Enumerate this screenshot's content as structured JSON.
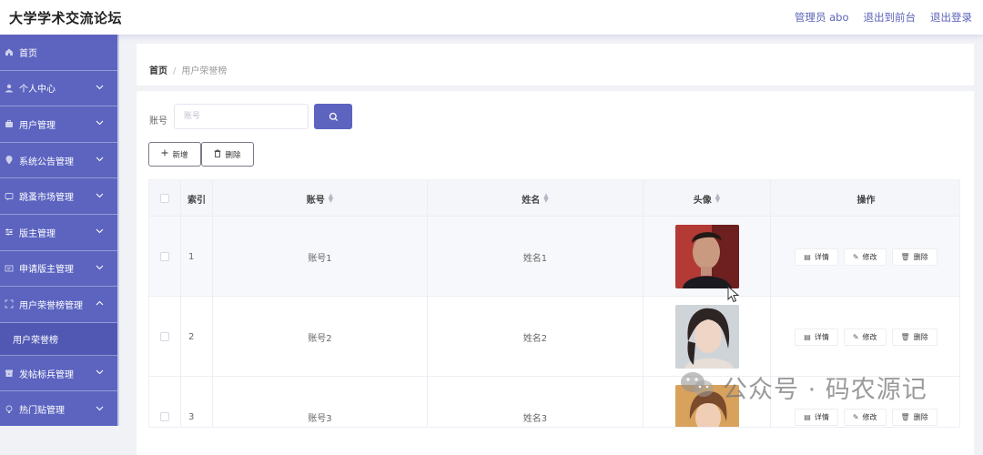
{
  "app": {
    "title": "大学学术交流论坛"
  },
  "header": {
    "links": [
      "管理员 abo",
      "退出到前台",
      "退出登录"
    ]
  },
  "sidebar": {
    "items": [
      {
        "label": "首页",
        "icon": "home-icon",
        "arrow": false
      },
      {
        "label": "个人中心",
        "icon": "user-icon",
        "arrow": true
      },
      {
        "label": "用户管理",
        "icon": "briefcase-icon",
        "arrow": true
      },
      {
        "label": "系统公告管理",
        "icon": "location-icon",
        "arrow": true
      },
      {
        "label": "跳蚤市场管理",
        "icon": "message-icon",
        "arrow": true
      },
      {
        "label": "版主管理",
        "icon": "sliders-icon",
        "arrow": true
      },
      {
        "label": "申请版主管理",
        "icon": "mail-icon",
        "arrow": true
      },
      {
        "label": "用户荣誉榜管理",
        "icon": "fullscreen-icon",
        "arrow": true,
        "expanded": true
      }
    ],
    "subitem": "用户荣誉榜",
    "items_after": [
      {
        "label": "发帖标兵管理",
        "icon": "archive-icon",
        "arrow": true
      },
      {
        "label": "热门贴管理",
        "icon": "bulb-icon",
        "arrow": true
      }
    ]
  },
  "breadcrumb": {
    "home": "首页",
    "separator": "/",
    "current": "用户荣誉榜"
  },
  "search": {
    "label": "账号",
    "placeholder": "账号",
    "value": ""
  },
  "actions": {
    "add_label": "新增",
    "delete_label": "删除"
  },
  "table": {
    "columns": [
      "索引",
      "账号",
      "姓名",
      "头像",
      "操作"
    ],
    "rows": [
      {
        "index": "1",
        "account": "账号1",
        "name": "姓名1"
      },
      {
        "index": "2",
        "account": "账号2",
        "name": "姓名2"
      },
      {
        "index": "3",
        "account": "账号3",
        "name": "姓名3"
      }
    ],
    "row_actions": [
      "详情",
      "修改",
      "删除"
    ]
  },
  "watermark": {
    "text": "公众号 · 码农源记"
  },
  "colors": {
    "accent": "#5c64c0",
    "sidebar": "#5c64c0"
  }
}
